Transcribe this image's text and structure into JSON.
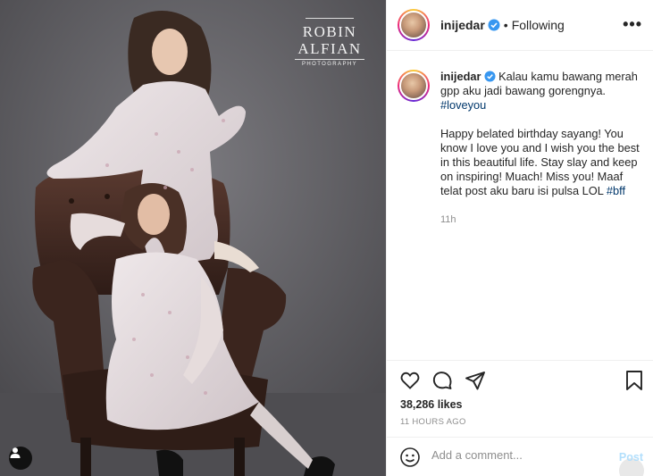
{
  "photo": {
    "watermark": {
      "line1": "ROBIN",
      "line2": "ALFIAN",
      "line3": "PHOTOGRAPHY"
    },
    "tag_icon": "person-icon"
  },
  "post": {
    "username": "inijedar",
    "separator": "•",
    "follow_status": "Following",
    "more_icon": "•••",
    "caption": {
      "username": "inijedar",
      "text1": " Kalau kamu bawang merah gpp aku jadi bawang gorengnya. ",
      "hashtag1": "#loveyou",
      "text2": "Happy belated birthday sayang! You know I love you and I wish you the best in this beautiful life. Stay slay and keep on inspiring! Muach! Miss you! Maaf telat post aku baru isi pulsa LOL ",
      "hashtag2": "#bff",
      "time": "11h"
    },
    "likes": "38,286 likes",
    "date": "11 HOURS AGO",
    "comment": {
      "placeholder": "Add a comment...",
      "post_label": "Post"
    }
  },
  "colors": {
    "accent_link": "#00376b",
    "verified": "#3897f0",
    "post_disabled": "#b2dffc",
    "muted": "#8e8e8e"
  }
}
